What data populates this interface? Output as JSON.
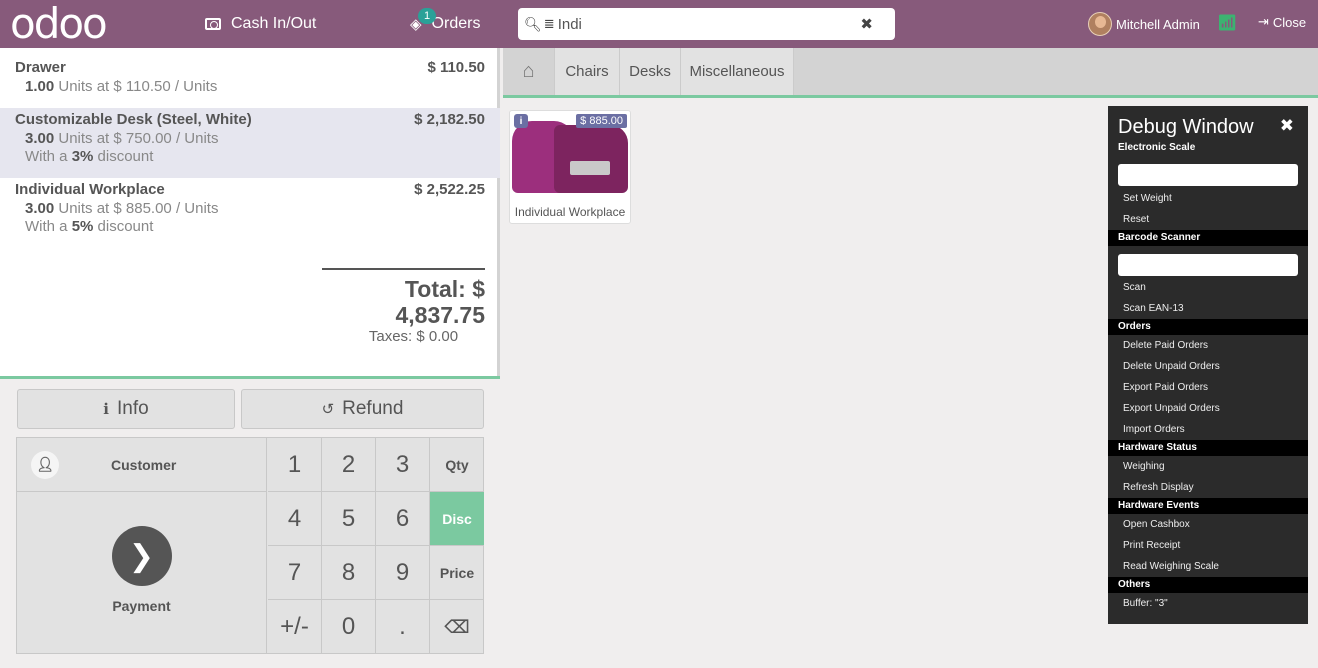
{
  "topbar": {
    "logo": "odoo",
    "cash_label": "Cash In/Out",
    "orders_label": "Orders",
    "orders_badge": "1",
    "search_value": "Indi",
    "user_name": "Mitchell Admin",
    "close_label": "Close"
  },
  "orderlines": [
    {
      "name": "Drawer",
      "price": "$ 110.50",
      "qty": "1.00",
      "unit_text": " Units at $ 110.50 / Units"
    },
    {
      "name": "Customizable Desk (Steel, White)",
      "price": "$ 2,182.50",
      "qty": "3.00",
      "unit_text": " Units at $ 750.00 / Units",
      "disc_prefix": "With a ",
      "disc": "3%",
      "disc_suffix": " discount"
    },
    {
      "name": "Individual Workplace",
      "price": "$ 2,522.25",
      "qty": "3.00",
      "unit_text": " Units at $ 885.00 / Units",
      "disc_prefix": "With a ",
      "disc": "5%",
      "disc_suffix": " discount"
    }
  ],
  "totals": {
    "total": "Total: $ 4,837.75",
    "taxes": "Taxes: $ 0.00"
  },
  "controls": {
    "info": "Info",
    "refund": "Refund",
    "customer": "Customer",
    "payment": "Payment",
    "keys": [
      "1",
      "2",
      "3",
      "4",
      "5",
      "6",
      "7",
      "8",
      "9",
      "+/-",
      "0",
      "."
    ],
    "modes": {
      "qty": "Qty",
      "disc": "Disc",
      "price": "Price"
    },
    "active_mode": "Disc"
  },
  "categories": [
    "Chairs",
    "Desks",
    "Miscellaneous"
  ],
  "products": [
    {
      "name": "Individual Workplace",
      "price": "$ 885.00"
    }
  ],
  "debug": {
    "title": "Debug Window",
    "sections": {
      "scale": "Electronic Scale",
      "barcode": "Barcode Scanner",
      "orders": "Orders",
      "hw_status": "Hardware Status",
      "hw_events": "Hardware Events",
      "others": "Others"
    },
    "items": {
      "set_weight": "Set Weight",
      "reset": "Reset",
      "scan": "Scan",
      "scan_ean": "Scan EAN-13",
      "del_paid": "Delete Paid Orders",
      "del_unpaid": "Delete Unpaid Orders",
      "exp_paid": "Export Paid Orders",
      "exp_unpaid": "Export Unpaid Orders",
      "import": "Import Orders",
      "weighing": "Weighing",
      "refresh": "Refresh Display",
      "open_cashbox": "Open Cashbox",
      "print_receipt": "Print Receipt",
      "read_scale": "Read Weighing Scale",
      "buffer": "Buffer: \"3\""
    }
  },
  "colors": {
    "brand": "#875a7b",
    "accent": "#7bc9a0",
    "tag": "#6b6fa3"
  }
}
